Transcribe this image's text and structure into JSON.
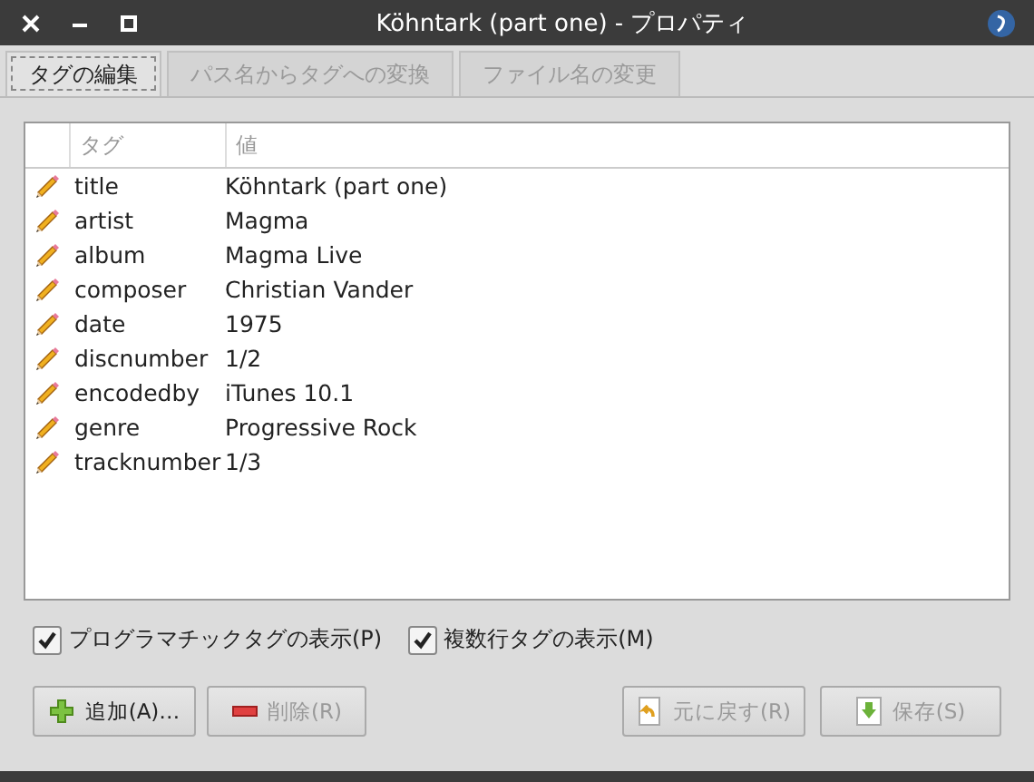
{
  "window": {
    "title": "Köhntark (part one) - プロパティ"
  },
  "tabs": [
    {
      "label": "タグの編集",
      "selected": true,
      "disabled": false
    },
    {
      "label": "パス名からタグへの変換",
      "selected": false,
      "disabled": true
    },
    {
      "label": "ファイル名の変更",
      "selected": false,
      "disabled": true
    }
  ],
  "table": {
    "columns": [
      "タグ",
      "値"
    ],
    "rows": [
      {
        "tag": "title",
        "value": "Köhntark (part one)"
      },
      {
        "tag": "artist",
        "value": "Magma"
      },
      {
        "tag": "album",
        "value": "Magma Live"
      },
      {
        "tag": "composer",
        "value": "Christian Vander"
      },
      {
        "tag": "date",
        "value": "1975"
      },
      {
        "tag": "discnumber",
        "value": "1/2"
      },
      {
        "tag": "encodedby",
        "value": "iTunes 10.1"
      },
      {
        "tag": "genre",
        "value": "Progressive Rock"
      },
      {
        "tag": "tracknumber",
        "value": "1/3"
      }
    ]
  },
  "options": [
    {
      "label": "プログラマチックタグの表示(P)",
      "checked": true
    },
    {
      "label": "複数行タグの表示(M)",
      "checked": true
    }
  ],
  "buttons": [
    {
      "kind": "add",
      "label": "追加(A)…",
      "disabled": false
    },
    {
      "kind": "remove",
      "label": "削除(R)",
      "disabled": true
    },
    {
      "kind": "revert",
      "label": "元に戻す(R)",
      "disabled": true
    },
    {
      "kind": "save",
      "label": "保存(S)",
      "disabled": true
    }
  ]
}
